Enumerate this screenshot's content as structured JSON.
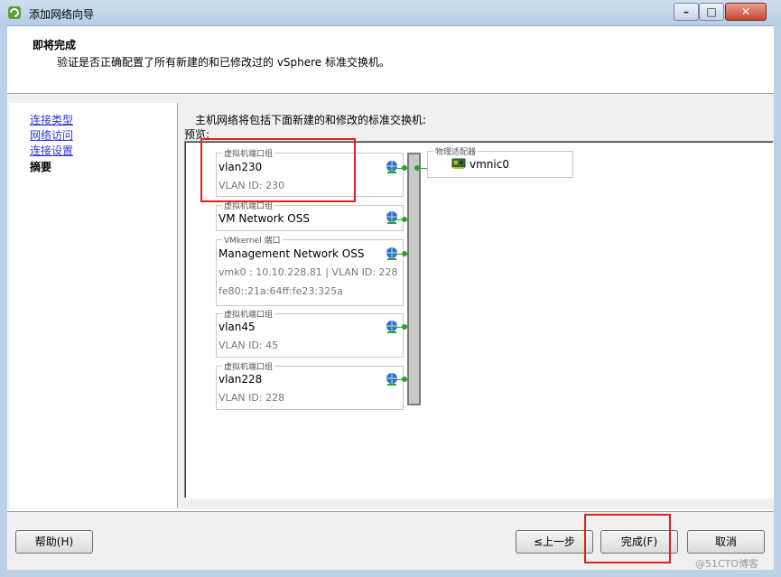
{
  "window": {
    "title": "添加网络向导"
  },
  "header": {
    "title": "即将完成",
    "subtitle": "验证是否正确配置了所有新建的和已修改过的 vSphere 标准交换机。"
  },
  "nav": {
    "items": [
      {
        "label": "连接类型",
        "state": "link"
      },
      {
        "label": "网络访问",
        "state": "link"
      },
      {
        "label": "连接设置",
        "state": "link"
      },
      {
        "label": "摘要",
        "state": "current"
      }
    ]
  },
  "main": {
    "description": "主机网络将包括下面新建的和修改的标准交换机:",
    "preview_label": "预览:",
    "port_groups": [
      {
        "caption": "虚拟机端口组",
        "name": "vlan230",
        "lines": [
          "VLAN ID: 230"
        ]
      },
      {
        "caption": "虚拟机端口组",
        "name": "VM Network OSS",
        "lines": []
      },
      {
        "caption": "VMkernel 端口",
        "name": "Management Network OSS",
        "lines": [
          "vmk0 : 10.10.228.81 | VLAN ID: 228",
          "fe80::21a:64ff:fe23:325a"
        ]
      },
      {
        "caption": "虚拟机端口组",
        "name": "vlan45",
        "lines": [
          "VLAN ID: 45"
        ]
      },
      {
        "caption": "虚拟机端口组",
        "name": "vlan228",
        "lines": [
          "VLAN ID: 228"
        ]
      }
    ],
    "physical_adapters": {
      "caption": "物理适配器",
      "adapter": "vmnic0"
    }
  },
  "footer": {
    "help": "帮助(H)",
    "back": "≤上一步",
    "finish": "完成(F)",
    "cancel": "取消"
  },
  "watermark": "@51CTO博客",
  "colors": {
    "link": "#2b38d6",
    "highlight": "#e02020",
    "connector": "#2ea02e"
  }
}
